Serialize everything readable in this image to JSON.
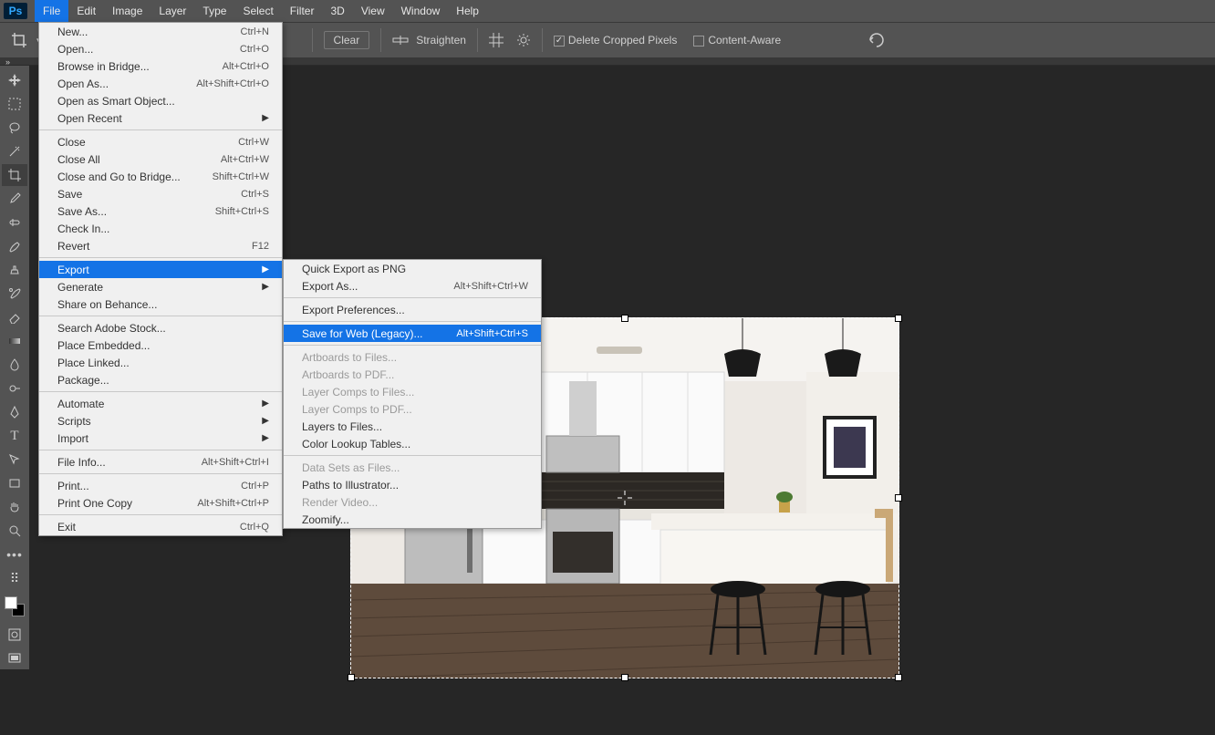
{
  "menubar": {
    "items": [
      "File",
      "Edit",
      "Image",
      "Layer",
      "Type",
      "Select",
      "Filter",
      "3D",
      "View",
      "Window",
      "Help"
    ],
    "open_index": 0
  },
  "optbar": {
    "clear": "Clear",
    "straighten": "Straighten",
    "delete_cropped": "Delete Cropped Pixels",
    "content_aware": "Content-Aware"
  },
  "file_menu": [
    {
      "label": "New...",
      "shortcut": "Ctrl+N"
    },
    {
      "label": "Open...",
      "shortcut": "Ctrl+O"
    },
    {
      "label": "Browse in Bridge...",
      "shortcut": "Alt+Ctrl+O"
    },
    {
      "label": "Open As...",
      "shortcut": "Alt+Shift+Ctrl+O"
    },
    {
      "label": "Open as Smart Object..."
    },
    {
      "label": "Open Recent",
      "submenu": true
    },
    {
      "sep": true
    },
    {
      "label": "Close",
      "shortcut": "Ctrl+W"
    },
    {
      "label": "Close All",
      "shortcut": "Alt+Ctrl+W"
    },
    {
      "label": "Close and Go to Bridge...",
      "shortcut": "Shift+Ctrl+W"
    },
    {
      "label": "Save",
      "shortcut": "Ctrl+S"
    },
    {
      "label": "Save As...",
      "shortcut": "Shift+Ctrl+S"
    },
    {
      "label": "Check In..."
    },
    {
      "label": "Revert",
      "shortcut": "F12"
    },
    {
      "sep": true
    },
    {
      "label": "Export",
      "submenu": true,
      "hl": true
    },
    {
      "label": "Generate",
      "submenu": true
    },
    {
      "label": "Share on Behance..."
    },
    {
      "sep": true
    },
    {
      "label": "Search Adobe Stock..."
    },
    {
      "label": "Place Embedded..."
    },
    {
      "label": "Place Linked..."
    },
    {
      "label": "Package..."
    },
    {
      "sep": true
    },
    {
      "label": "Automate",
      "submenu": true
    },
    {
      "label": "Scripts",
      "submenu": true
    },
    {
      "label": "Import",
      "submenu": true
    },
    {
      "sep": true
    },
    {
      "label": "File Info...",
      "shortcut": "Alt+Shift+Ctrl+I"
    },
    {
      "sep": true
    },
    {
      "label": "Print...",
      "shortcut": "Ctrl+P"
    },
    {
      "label": "Print One Copy",
      "shortcut": "Alt+Shift+Ctrl+P"
    },
    {
      "sep": true
    },
    {
      "label": "Exit",
      "shortcut": "Ctrl+Q"
    }
  ],
  "export_menu": [
    {
      "label": "Quick Export as PNG"
    },
    {
      "label": "Export As...",
      "shortcut": "Alt+Shift+Ctrl+W"
    },
    {
      "sep": true
    },
    {
      "label": "Export Preferences..."
    },
    {
      "sep": true
    },
    {
      "label": "Save for Web (Legacy)...",
      "shortcut": "Alt+Shift+Ctrl+S",
      "hl": true
    },
    {
      "sep": true
    },
    {
      "label": "Artboards to Files...",
      "dis": true
    },
    {
      "label": "Artboards to PDF...",
      "dis": true
    },
    {
      "label": "Layer Comps to Files...",
      "dis": true
    },
    {
      "label": "Layer Comps to PDF...",
      "dis": true
    },
    {
      "label": "Layers to Files..."
    },
    {
      "label": "Color Lookup Tables..."
    },
    {
      "sep": true
    },
    {
      "label": "Data Sets as Files...",
      "dis": true
    },
    {
      "label": "Paths to Illustrator..."
    },
    {
      "label": "Render Video...",
      "dis": true
    },
    {
      "label": "Zoomify..."
    }
  ],
  "tools": [
    "move",
    "marquee",
    "lasso",
    "magic-wand",
    "crop",
    "eyedropper",
    "healing",
    "brush",
    "clone",
    "history-brush",
    "eraser",
    "gradient",
    "blur",
    "dodge",
    "pen",
    "type",
    "path-select",
    "rectangle",
    "hand",
    "zoom",
    "more",
    "edit-toolbar",
    "swatch",
    "quick-mask",
    "screen-mode"
  ]
}
